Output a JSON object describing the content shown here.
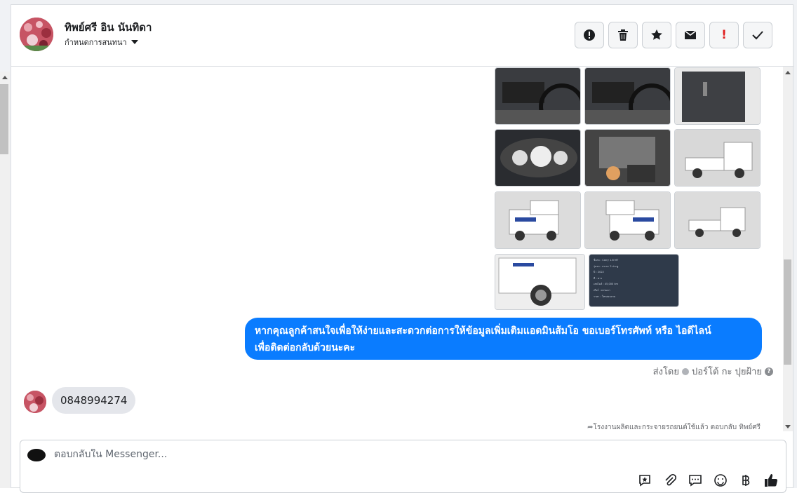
{
  "header": {
    "contact_name": "ทิพย์ศรี อิน นันทิดา",
    "assign_label": "กำหนดการสนทนา"
  },
  "toolbar": {
    "buttons": [
      "spam-alert",
      "delete",
      "star",
      "mail",
      "important",
      "done"
    ],
    "important_glyph": "!"
  },
  "thread": {
    "outgoing_message_line1": "หากคุณลูกค้าสนใจเพื่อให้ง่ายและสะดวกต่อการให้ข้อมูลเพิ่มเติมแอดมินส้มโอ ขอเบอร์โทรศัพท์ หรือ ไอดีไลน์",
    "outgoing_message_line2": "เพื่อติดต่อกลับด้วยนะคะ",
    "sent_by_label": "ส่งโดย",
    "sent_by_name": "ปอร์โต้ กะ ปุยฝ้าย",
    "help_glyph": "?",
    "incoming_message": "0848994274",
    "reply_note": "โรงงานผลิตและกระจายรถยนต์ใช้แล้ว ตอบกลับ ทิพย์ศรี"
  },
  "photos": {
    "spec_card_lines": [
      "ชื่อรถ : Carry 1.6 MT",
      "รุ่นรถ : กระบะ 2 ประตู",
      "ปี : 2022",
      "สี : ขาว",
      "เลขไมล์ : 45,000 km",
      "เกียร์ : ธรรมดา",
      "ราคา : โทรสอบถาม"
    ]
  },
  "composer": {
    "placeholder": "ตอบกลับใน Messenger..."
  },
  "colors": {
    "accent": "#0a7cff",
    "incoming_bubble": "#e4e6eb",
    "important": "#e02020"
  }
}
